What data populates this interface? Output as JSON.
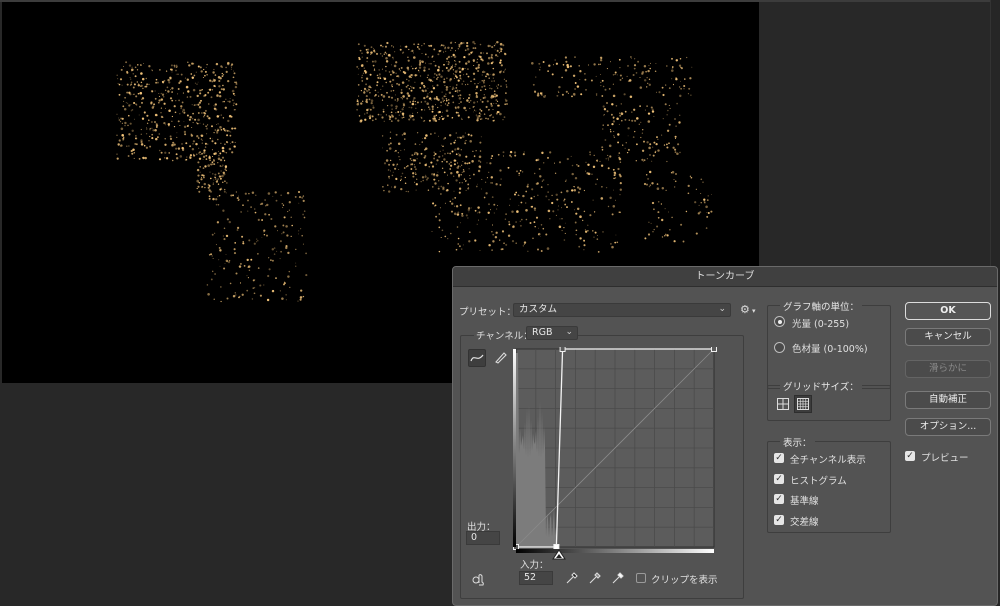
{
  "dialog": {
    "title": "トーンカーブ",
    "preset_label": "プリセット：",
    "preset_value": "カスタム",
    "channel_label": "チャンネル：",
    "channel_value": "RGB",
    "output_label": "出力：",
    "output_value": "0",
    "input_label": "入力：",
    "input_value": "52",
    "clip_label": "クリップを表示",
    "clip_checked": false,
    "graph_units": {
      "title": "グラフ軸の単位：",
      "options": [
        {
          "label": "光量 (0-255)",
          "selected": true
        },
        {
          "label": "色材量 (0-100%)",
          "selected": false
        }
      ]
    },
    "grid_size": {
      "title": "グリッドサイズ：",
      "selected": "detailed"
    },
    "display": {
      "title": "表示：",
      "options": [
        {
          "label": "全チャンネル表示",
          "checked": true
        },
        {
          "label": "ヒストグラム",
          "checked": true
        },
        {
          "label": "基準線",
          "checked": true
        },
        {
          "label": "交差線",
          "checked": true
        }
      ]
    },
    "buttons": {
      "ok": "OK",
      "cancel": "キャンセル",
      "smooth": "滑らかに",
      "auto": "自動補正",
      "options": "オプション..."
    },
    "preview_label": "プレビュー",
    "preview_checked": true
  },
  "curve": {
    "input_range": [
      0,
      255
    ],
    "output_range": [
      0,
      255
    ],
    "points": [
      [
        0,
        0
      ],
      [
        52,
        0
      ],
      [
        60,
        255
      ],
      [
        255,
        255
      ]
    ],
    "selected_point": [
      52,
      0
    ]
  },
  "colors": {
    "dialog_bg": "#535353",
    "doc_bg": "#000000",
    "city_lights": "#f3c47a"
  }
}
